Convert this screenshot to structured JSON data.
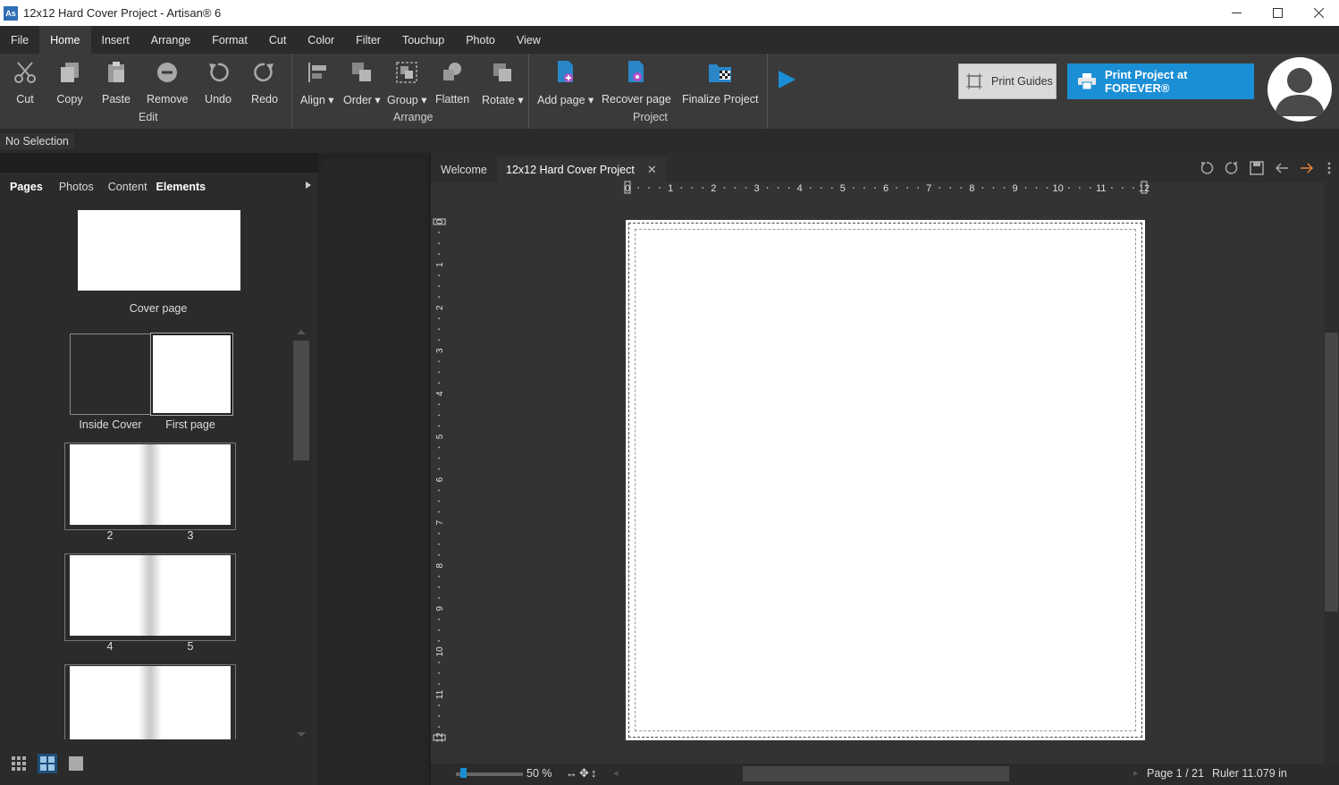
{
  "window": {
    "title": "12x12 Hard Cover Project - Artisan® 6",
    "app_icon": "artisan-logo-icon",
    "controls": [
      "minimize-icon",
      "maximize-icon",
      "close-icon"
    ]
  },
  "menu": [
    "File",
    "Home",
    "Insert",
    "Arrange",
    "Format",
    "Cut",
    "Color",
    "Filter",
    "Touchup",
    "Photo",
    "View"
  ],
  "menu_active": "Home",
  "ribbon": {
    "edit": {
      "label": "Edit",
      "buttons": [
        {
          "label": "Cut",
          "icon": "scissors-icon"
        },
        {
          "label": "Copy",
          "icon": "copy-icon"
        },
        {
          "label": "Paste",
          "icon": "paste-icon"
        },
        {
          "label": "Remove",
          "icon": "remove-icon"
        },
        {
          "label": "Undo",
          "icon": "undo-icon"
        },
        {
          "label": "Redo",
          "icon": "redo-icon"
        }
      ]
    },
    "arrange": {
      "label": "Arrange",
      "buttons": [
        {
          "label": "Align",
          "icon": "align-icon"
        },
        {
          "label": "Order",
          "icon": "order-icon"
        },
        {
          "label": "Group",
          "icon": "group-icon"
        },
        {
          "label": "Flatten",
          "icon": "flatten-icon"
        },
        {
          "label": "Rotate",
          "icon": "rotate-icon"
        }
      ]
    },
    "project": {
      "label": "Project",
      "buttons": [
        {
          "label": "Add page",
          "icon": "add-page-icon"
        },
        {
          "label": "Recover page",
          "icon": "recover-page-icon"
        },
        {
          "label": "Finalize Project",
          "icon": "finalize-project-icon"
        }
      ]
    },
    "print_guides": "Print Guides",
    "print_forever": "Print Project at FOREVER®",
    "accent": "#1b8fd6"
  },
  "selection_status": "No Selection",
  "panel": {
    "tabs": [
      "Pages",
      "Photos",
      "Content",
      "Elements"
    ],
    "active_tab": "Pages",
    "thumbs": {
      "cover": "Cover page",
      "inside_cover": "Inside Cover",
      "first_page": "First page",
      "p2": "2",
      "p3": "3",
      "p4": "4",
      "p5": "5"
    }
  },
  "doc_tabs": {
    "welcome": "Welcome",
    "project": "12x12 Hard Cover Project",
    "close": "✕"
  },
  "ruler_ticks": [
    "0",
    "1",
    "2",
    "3",
    "4",
    "5",
    "6",
    "7",
    "8",
    "9",
    "10",
    "11",
    "12"
  ],
  "status": {
    "zoom": "50 %",
    "page": "Page 1 / 21",
    "ruler": "Ruler 11.079 in"
  }
}
